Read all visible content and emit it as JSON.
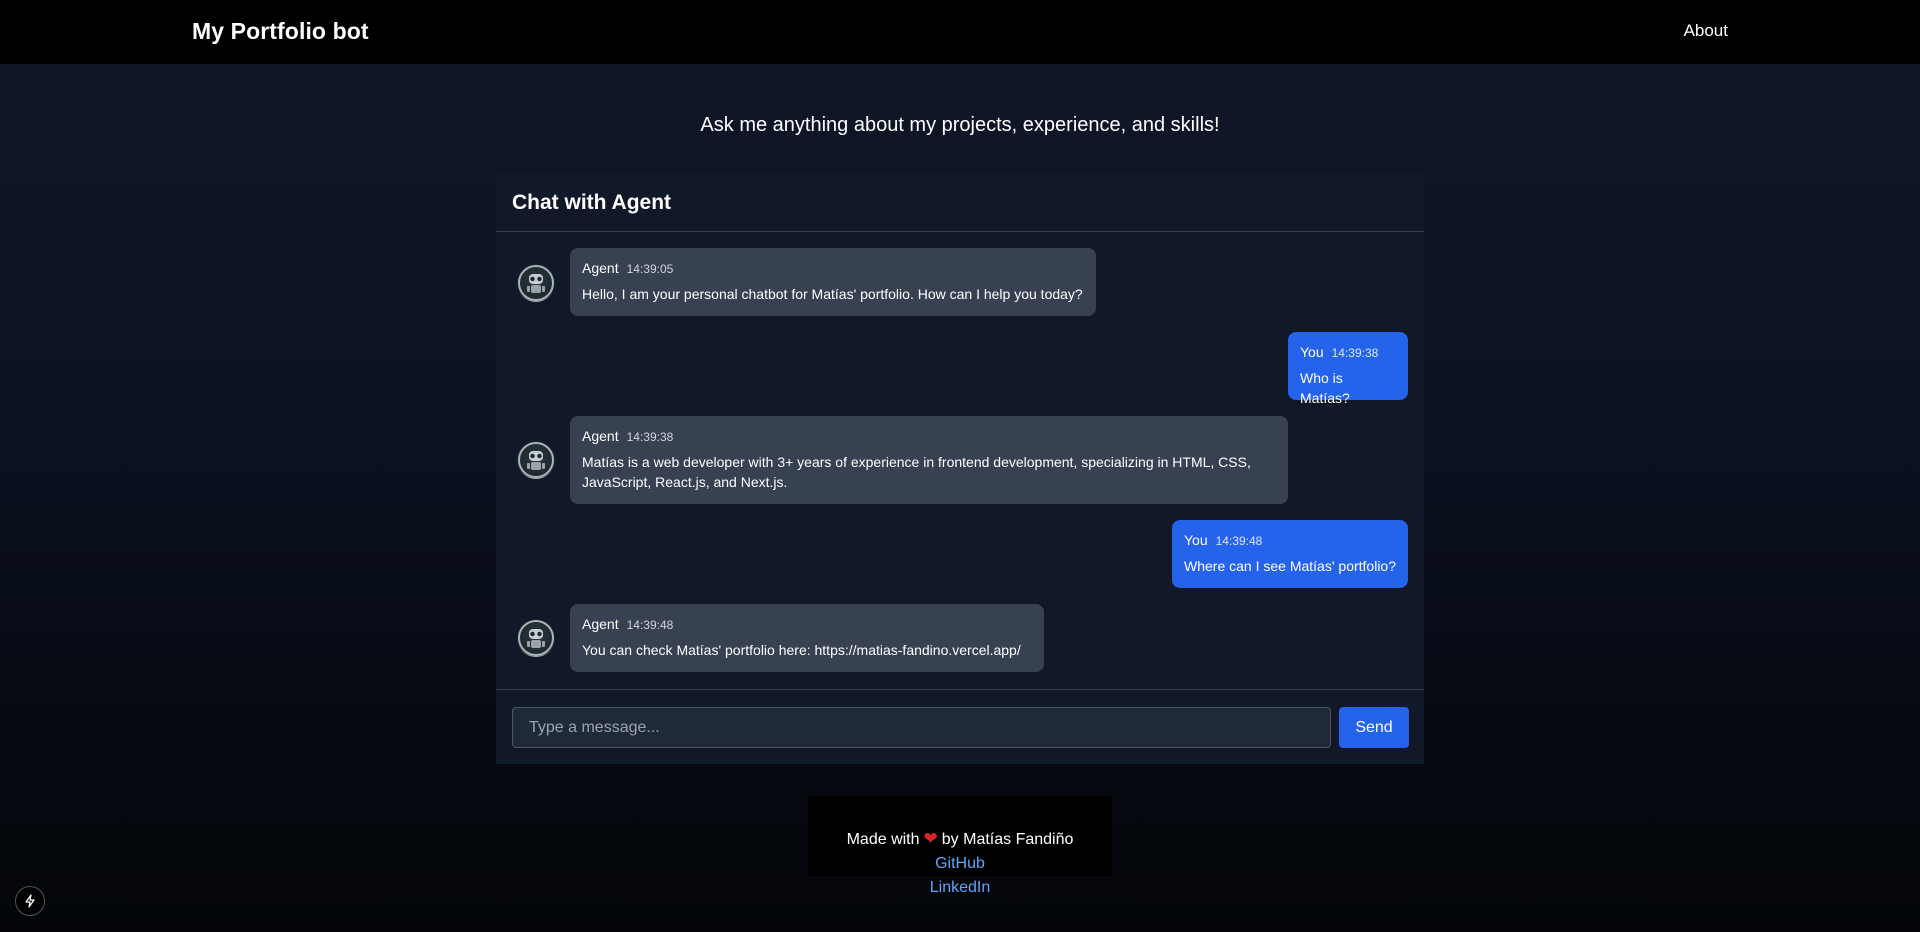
{
  "nav": {
    "brand": "My Portfolio bot",
    "about": "About"
  },
  "tagline": "Ask me anything about my projects, experience, and skills!",
  "chat": {
    "title": "Chat with Agent",
    "messages": [
      {
        "sender": "Agent",
        "time": "14:39:05",
        "role": "agent",
        "text": "Hello, I am your personal chatbot for Matías' portfolio. How can I help you today?"
      },
      {
        "sender": "You",
        "time": "14:39:38",
        "role": "user",
        "text": "Who is Matías?"
      },
      {
        "sender": "Agent",
        "time": "14:39:38",
        "role": "agent",
        "text": "Matías is a web developer with 3+ years of experience in frontend development, specializing in HTML, CSS, JavaScript, React.js, and Next.js."
      },
      {
        "sender": "You",
        "time": "14:39:48",
        "role": "user",
        "text": "Where can I see Matías' portfolio?"
      },
      {
        "sender": "Agent",
        "time": "14:39:48",
        "role": "agent",
        "text": "You can check Matías' portfolio here: https://matias-fandino.vercel.app/"
      }
    ],
    "input_placeholder": "Type a message...",
    "send_label": "Send"
  },
  "footer": {
    "made_with": "Made with",
    "by": "by Matías Fandiño",
    "github": "GitHub",
    "linkedin": "LinkedIn"
  },
  "icons": {
    "avatar": "robot-avatar-icon",
    "heart": "heart-icon",
    "bolt": "lightning-bolt-icon"
  },
  "colors": {
    "user_bubble": "#2563eb",
    "agent_bubble": "#374151",
    "link": "#60a5fa",
    "heart": "#dc2626"
  }
}
